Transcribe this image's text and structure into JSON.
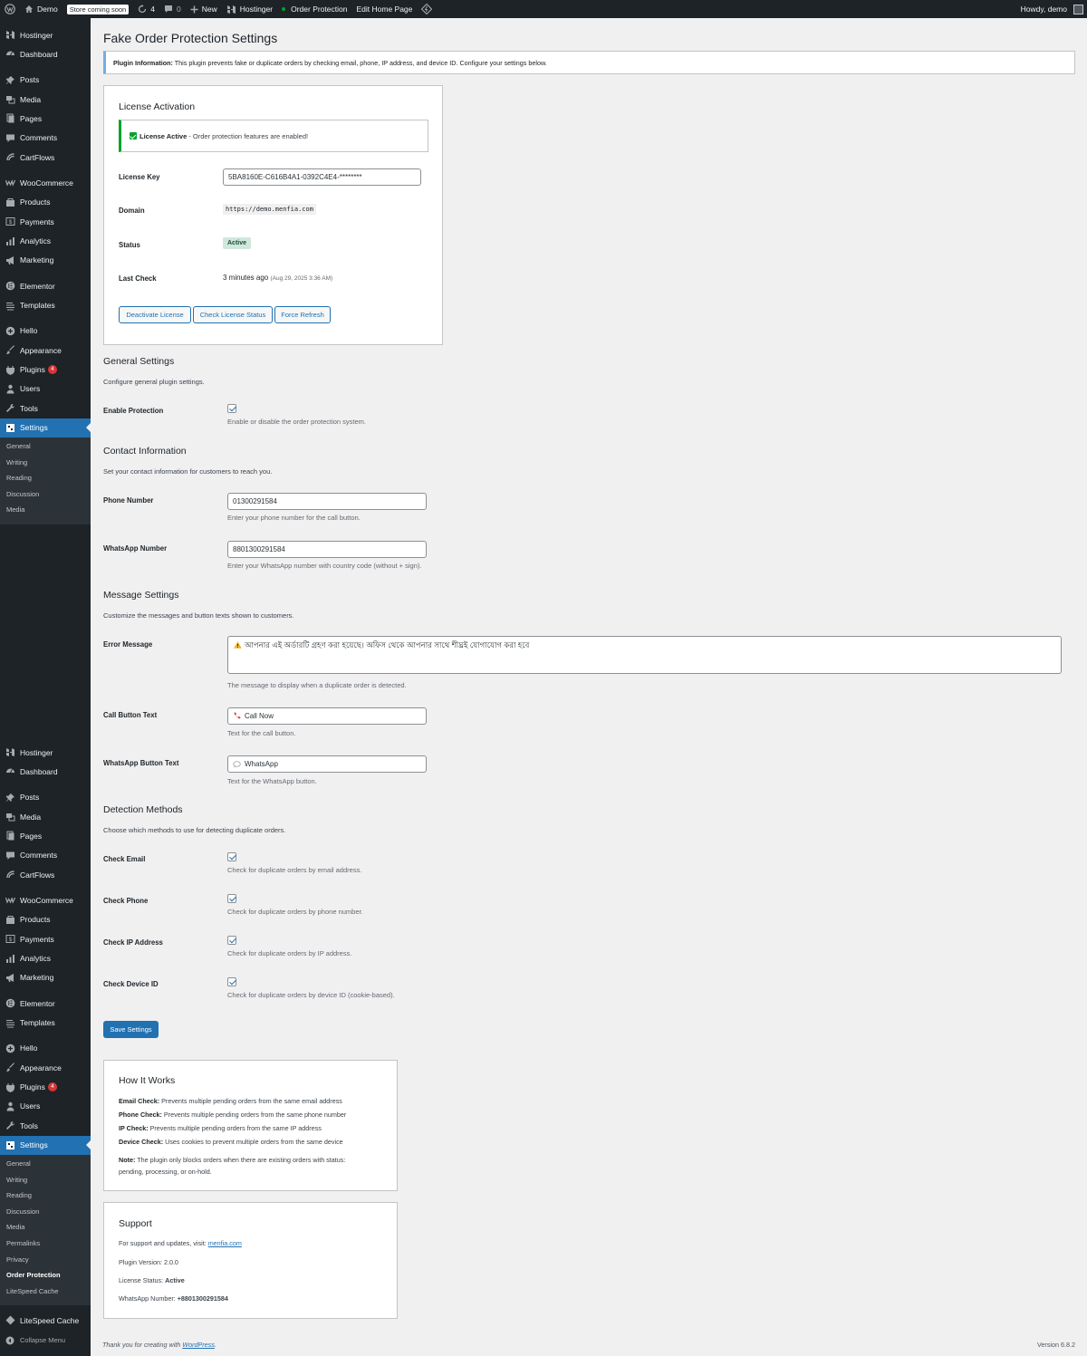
{
  "admin_bar": {
    "site_name": "Demo",
    "coming_soon": "Store coming soon",
    "updates_count": "4",
    "comments_count": "0",
    "new_label": "New",
    "hostinger_label": "Hostinger",
    "order_protection_label": "Order Protection",
    "edit_home_label": "Edit Home Page",
    "howdy": "Howdy, demo"
  },
  "sidebar": {
    "top_menu": [
      {
        "label": "Hostinger",
        "icon": "hostinger-icon"
      },
      {
        "label": "Dashboard",
        "icon": "dashboard-icon"
      },
      {
        "label": "Posts",
        "icon": "pin-icon"
      },
      {
        "label": "Media",
        "icon": "media-icon"
      },
      {
        "label": "Pages",
        "icon": "pages-icon"
      },
      {
        "label": "Comments",
        "icon": "comments-icon"
      },
      {
        "label": "CartFlows",
        "icon": "cartflows-icon"
      },
      {
        "label": "WooCommerce",
        "icon": "woocommerce-icon"
      },
      {
        "label": "Products",
        "icon": "products-icon"
      },
      {
        "label": "Payments",
        "icon": "payments-icon"
      },
      {
        "label": "Analytics",
        "icon": "analytics-icon"
      },
      {
        "label": "Marketing",
        "icon": "megaphone-icon"
      },
      {
        "label": "Elementor",
        "icon": "elementor-icon"
      },
      {
        "label": "Templates",
        "icon": "templates-icon"
      },
      {
        "label": "Hello",
        "icon": "hello-icon"
      },
      {
        "label": "Appearance",
        "icon": "brush-icon"
      },
      {
        "label": "Plugins",
        "icon": "plugin-icon",
        "badge": "4"
      },
      {
        "label": "Users",
        "icon": "users-icon"
      },
      {
        "label": "Tools",
        "icon": "tools-icon"
      },
      {
        "label": "Settings",
        "icon": "settings-icon"
      }
    ],
    "top_submenu": [
      "General",
      "Writing",
      "Reading",
      "Discussion",
      "Media"
    ],
    "bottom_menu": [
      {
        "label": "Hostinger",
        "icon": "hostinger-icon"
      },
      {
        "label": "Dashboard",
        "icon": "dashboard-icon"
      },
      {
        "label": "Posts",
        "icon": "pin-icon"
      },
      {
        "label": "Media",
        "icon": "media-icon"
      },
      {
        "label": "Pages",
        "icon": "pages-icon"
      },
      {
        "label": "Comments",
        "icon": "comments-icon"
      },
      {
        "label": "CartFlows",
        "icon": "cartflows-icon"
      },
      {
        "label": "WooCommerce",
        "icon": "woocommerce-icon"
      },
      {
        "label": "Products",
        "icon": "products-icon"
      },
      {
        "label": "Payments",
        "icon": "payments-icon"
      },
      {
        "label": "Analytics",
        "icon": "analytics-icon"
      },
      {
        "label": "Marketing",
        "icon": "megaphone-icon"
      },
      {
        "label": "Elementor",
        "icon": "elementor-icon"
      },
      {
        "label": "Templates",
        "icon": "templates-icon"
      },
      {
        "label": "Hello",
        "icon": "hello-icon"
      },
      {
        "label": "Appearance",
        "icon": "brush-icon"
      },
      {
        "label": "Plugins",
        "icon": "plugin-icon",
        "badge": "4"
      },
      {
        "label": "Users",
        "icon": "users-icon"
      },
      {
        "label": "Tools",
        "icon": "tools-icon"
      },
      {
        "label": "Settings",
        "icon": "settings-icon"
      }
    ],
    "bottom_submenu": [
      "General",
      "Writing",
      "Reading",
      "Discussion",
      "Media",
      "Permalinks",
      "Privacy",
      "Order Protection",
      "LiteSpeed Cache"
    ],
    "litespeed_label": "LiteSpeed Cache",
    "collapse_label": "Collapse Menu"
  },
  "page": {
    "title": "Fake Order Protection Settings",
    "notice_bold": "Plugin Information:",
    "notice_text": " This plugin prevents fake or duplicate orders by checking email, phone, IP address, and device ID. Configure your settings below."
  },
  "license": {
    "title": "License Activation",
    "status_bold": "License Active",
    "status_text": " - Order protection features are enabled!",
    "key_label": "License Key",
    "key_value": "5BA8160E-C616B4A1-0392C4E4-********",
    "domain_label": "Domain",
    "domain_value": "https://demo.menfia.com",
    "status_label": "Status",
    "status_value": "Active",
    "last_check_label": "Last Check",
    "last_check_value": "3 minutes ago",
    "last_check_date": "(Aug 29, 2025 3:36 AM)",
    "btn_deactivate": "Deactivate License",
    "btn_check": "Check License Status",
    "btn_refresh": "Force Refresh"
  },
  "general": {
    "title": "General Settings",
    "desc": "Configure general plugin settings.",
    "enable_label": "Enable Protection",
    "enable_desc": "Enable or disable the order protection system.",
    "enable_checked": true
  },
  "contact": {
    "title": "Contact Information",
    "desc": "Set your contact information for customers to reach you.",
    "phone_label": "Phone Number",
    "phone_value": "01300291584",
    "phone_desc": "Enter your phone number for the call button.",
    "whatsapp_label": "WhatsApp Number",
    "whatsapp_value": "8801300291584",
    "whatsapp_desc": "Enter your WhatsApp number with country code (without + sign)."
  },
  "message": {
    "title": "Message Settings",
    "desc": "Customize the messages and button texts shown to customers.",
    "error_label": "Error Message",
    "error_value": "আপনার এই অর্ডারটি গ্রহণ করা হয়েছে। অফিস থেকে আপনার সাথে শীঘ্রই যোগাযোগ করা হবে",
    "error_desc": "The message to display when a duplicate order is detected.",
    "call_label": "Call Button Text",
    "call_value": "Call Now",
    "call_desc": "Text for the call button.",
    "wa_label": "WhatsApp Button Text",
    "wa_value": "WhatsApp",
    "wa_desc": "Text for the WhatsApp button."
  },
  "detection": {
    "title": "Detection Methods",
    "desc": "Choose which methods to use for detecting duplicate orders.",
    "items": [
      {
        "label": "Check Email",
        "desc": "Check for duplicate orders by email address.",
        "checked": true
      },
      {
        "label": "Check Phone",
        "desc": "Check for duplicate orders by phone number.",
        "checked": true
      },
      {
        "label": "Check IP Address",
        "desc": "Check for duplicate orders by IP address.",
        "checked": true
      },
      {
        "label": "Check Device ID",
        "desc": "Check for duplicate orders by device ID (cookie-based).",
        "checked": true
      }
    ]
  },
  "save_label": "Save Settings",
  "how": {
    "title": "How It Works",
    "email_b": "Email Check:",
    "email_t": " Prevents multiple pending orders from the same email address",
    "phone_b": "Phone Check:",
    "phone_t": " Prevents multiple pending orders from the same phone number",
    "ip_b": "IP Check:",
    "ip_t": " Prevents multiple pending orders from the same IP address",
    "device_b": "Device Check:",
    "device_t": " Uses cookies to prevent multiple orders from the same device",
    "note_b": "Note:",
    "note_t1": " The plugin only blocks orders when there are existing orders with status:",
    "note_t2": "pending, processing, or on-hold."
  },
  "support": {
    "title": "Support",
    "visit_text": "For support and updates, visit: ",
    "link": "menfia.com",
    "version": "Plugin Version: 2.0.0",
    "lic_label": "License Status: ",
    "lic_value": "Active",
    "wa_label": "WhatsApp Number: ",
    "wa_value": "+8801300291584"
  },
  "footer": {
    "thanks": "Thank you for creating with ",
    "wp_link": "WordPress",
    "period": ".",
    "version": "Version 6.8.2"
  },
  "colors": {
    "admin_bg": "#1d2327",
    "accent": "#2271b1",
    "success": "#00a32a",
    "page_bg": "#f0f0f1"
  }
}
